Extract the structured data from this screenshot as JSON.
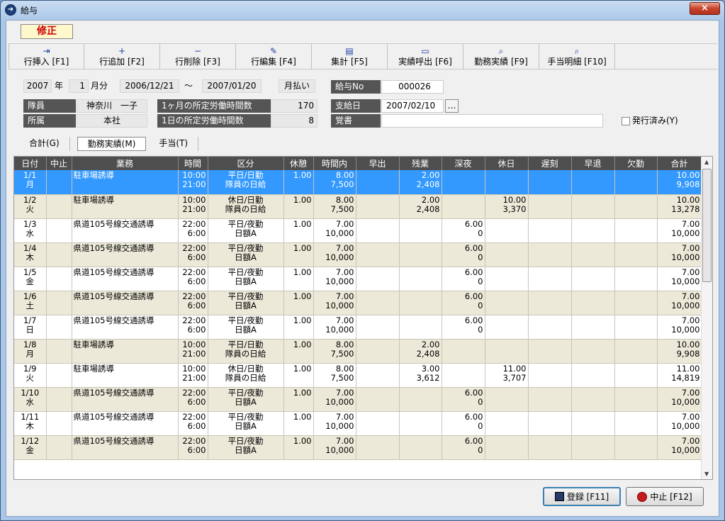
{
  "window": {
    "title": "給与",
    "close": "×"
  },
  "mode": "修正",
  "toolbar": [
    {
      "icon": "insert-row-icon",
      "glyph": "⇥",
      "label": "行挿入 [F1]"
    },
    {
      "icon": "add-row-icon",
      "glyph": "+",
      "label": "行追加 [F2]"
    },
    {
      "icon": "delete-row-icon",
      "glyph": "−",
      "label": "行削除 [F3]"
    },
    {
      "icon": "edit-row-icon",
      "glyph": "✎",
      "label": "行編集 [F4]"
    },
    {
      "icon": "summary-icon",
      "glyph": "▤",
      "label": "集計 [F5]"
    },
    {
      "icon": "open-folder-icon",
      "glyph": "▭",
      "label": "実績呼出 [F6]"
    },
    {
      "icon": "preview-icon",
      "glyph": "⌕",
      "label": "勤務実績 [F9]"
    },
    {
      "icon": "preview-icon",
      "glyph": "⌕",
      "label": "手当明細 [F10]"
    }
  ],
  "header": {
    "year": "2007",
    "year_label": "年",
    "month": "1",
    "month_label": "月分",
    "from": "2006/12/21",
    "tilde": "～",
    "to": "2007/01/20",
    "pay_type": "月払い",
    "salary_no_label": "給与No",
    "salary_no": "000026",
    "member_label": "隊員",
    "member": "神奈川　一子",
    "month_hours_label": "1ヶ月の所定労働時間数",
    "month_hours": "170",
    "pay_date_label": "支給日",
    "pay_date": "2007/02/10",
    "pay_date_btn": "…",
    "dept_label": "所属",
    "dept": "本社",
    "day_hours_label": "1日の所定労働時間数",
    "day_hours": "8",
    "memo_label": "覚書",
    "memo": "",
    "issued_label": "発行済み(Y)"
  },
  "tabs": [
    "合計(G)",
    "勤務実績(M)",
    "手当(T)"
  ],
  "columns": [
    "日付",
    "中止",
    "業務",
    "時間",
    "区分",
    "休憩",
    "時間内",
    "早出",
    "残業",
    "深夜",
    "休日",
    "遅刻",
    "早退",
    "欠勤",
    "合計"
  ],
  "rows": [
    [
      "1/1\n月",
      "",
      "駐車場誘導",
      "10:00\n21:00",
      "平日/日勤\n隊員の日給",
      "1.00",
      "8.00\n7,500",
      "",
      "2.00\n2,408",
      "",
      "",
      "",
      "",
      "",
      "10.00\n9,908"
    ],
    [
      "1/2\n火",
      "",
      "駐車場誘導",
      "10:00\n21:00",
      "休日/日勤\n隊員の日給",
      "1.00",
      "8.00\n7,500",
      "",
      "2.00\n2,408",
      "",
      "10.00\n3,370",
      "",
      "",
      "",
      "10.00\n13,278"
    ],
    [
      "1/3\n水",
      "",
      "県道105号線交通誘導",
      "22:00\n6:00",
      "平日/夜勤\n日額A",
      "1.00",
      "7.00\n10,000",
      "",
      "",
      "6.00\n0",
      "",
      "",
      "",
      "",
      "7.00\n10,000"
    ],
    [
      "1/4\n木",
      "",
      "県道105号線交通誘導",
      "22:00\n6:00",
      "平日/夜勤\n日額A",
      "1.00",
      "7.00\n10,000",
      "",
      "",
      "6.00\n0",
      "",
      "",
      "",
      "",
      "7.00\n10,000"
    ],
    [
      "1/5\n金",
      "",
      "県道105号線交通誘導",
      "22:00\n6:00",
      "平日/夜勤\n日額A",
      "1.00",
      "7.00\n10,000",
      "",
      "",
      "6.00\n0",
      "",
      "",
      "",
      "",
      "7.00\n10,000"
    ],
    [
      "1/6\n土",
      "",
      "県道105号線交通誘導",
      "22:00\n6:00",
      "平日/夜勤\n日額A",
      "1.00",
      "7.00\n10,000",
      "",
      "",
      "6.00\n0",
      "",
      "",
      "",
      "",
      "7.00\n10,000"
    ],
    [
      "1/7\n日",
      "",
      "県道105号線交通誘導",
      "22:00\n6:00",
      "平日/夜勤\n日額A",
      "1.00",
      "7.00\n10,000",
      "",
      "",
      "6.00\n0",
      "",
      "",
      "",
      "",
      "7.00\n10,000"
    ],
    [
      "1/8\n月",
      "",
      "駐車場誘導",
      "10:00\n21:00",
      "平日/日勤\n隊員の日給",
      "1.00",
      "8.00\n7,500",
      "",
      "2.00\n2,408",
      "",
      "",
      "",
      "",
      "",
      "10.00\n9,908"
    ],
    [
      "1/9\n火",
      "",
      "駐車場誘導",
      "10:00\n21:00",
      "休日/日勤\n隊員の日給",
      "1.00",
      "8.00\n7,500",
      "",
      "3.00\n3,612",
      "",
      "11.00\n3,707",
      "",
      "",
      "",
      "11.00\n14,819"
    ],
    [
      "1/10\n水",
      "",
      "県道105号線交通誘導",
      "22:00\n6:00",
      "平日/夜勤\n日額A",
      "1.00",
      "7.00\n10,000",
      "",
      "",
      "6.00\n0",
      "",
      "",
      "",
      "",
      "7.00\n10,000"
    ],
    [
      "1/11\n木",
      "",
      "県道105号線交通誘導",
      "22:00\n6:00",
      "平日/夜勤\n日額A",
      "1.00",
      "7.00\n10,000",
      "",
      "",
      "6.00\n0",
      "",
      "",
      "",
      "",
      "7.00\n10,000"
    ],
    [
      "1/12\n金",
      "",
      "県道105号線交通誘導",
      "22:00\n6:00",
      "平日/夜勤\n日額A",
      "1.00",
      "7.00\n10,000",
      "",
      "",
      "6.00\n0",
      "",
      "",
      "",
      "",
      "7.00\n10,000"
    ]
  ],
  "buttons": {
    "save": "登録 [F11]",
    "cancel": "中止 [F12]"
  }
}
